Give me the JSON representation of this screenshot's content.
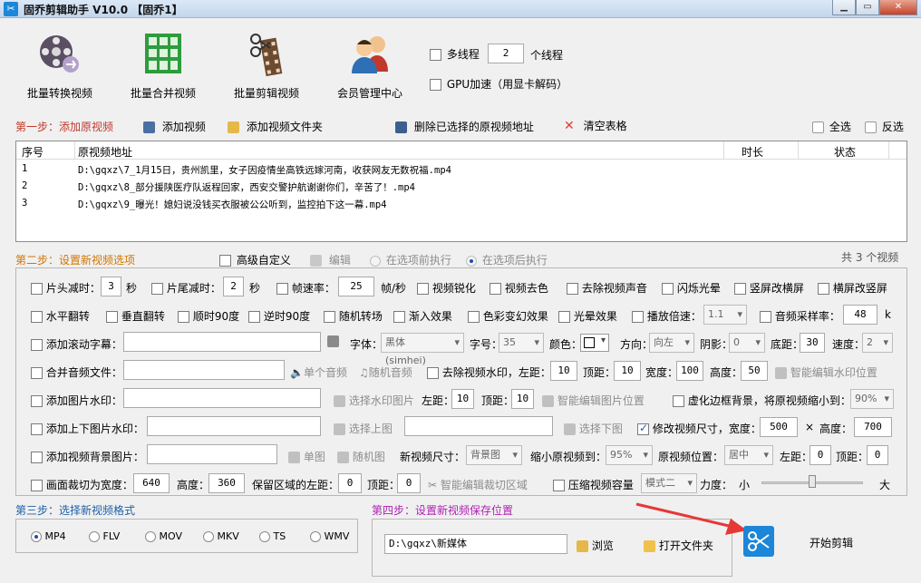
{
  "window": {
    "title": "固乔剪辑助手 V10.0 【固乔1】"
  },
  "toolbar": {
    "batch_convert": "批量转换视频",
    "batch_merge": "批量合并视频",
    "batch_edit": "批量剪辑视频",
    "member_center": "会员管理中心",
    "multithread_label": "多线程",
    "thread_count": "2",
    "thread_unit": "个线程",
    "gpu_label": "GPU加速（用显卡解码）"
  },
  "step1": {
    "title": "第一步：添加原视频",
    "add_video": "添加视频",
    "add_folder": "添加视频文件夹",
    "delete_selected": "删除已选择的原视频地址",
    "clear_table": "清空表格",
    "select_all": "全选",
    "invert_select": "反选"
  },
  "table": {
    "headers": [
      "序号",
      "原视频地址",
      "时长",
      "状态"
    ],
    "rows": [
      {
        "no": "1",
        "path": "D:\\gqxz\\7_1月15日，贵州凯里，女子因疫情坐高铁远嫁河南，收获网友无数祝福.mp4"
      },
      {
        "no": "2",
        "path": "D:\\gqxz\\8_部分援陕医疗队返程回家，西安交警护航谢谢你们，辛苦了！.mp4"
      },
      {
        "no": "3",
        "path": "D:\\gqxz\\9_曝光！媳妇说没钱买衣服被公公听到，监控拍下这一幕.mp4"
      }
    ]
  },
  "step2": {
    "title": "第二步：设置新视频选项",
    "advanced_custom": "高级自定义",
    "edit": "编辑",
    "before_exec": "在选项前执行",
    "after_exec": "在选项后执行",
    "total_count": "共 3 个视频"
  },
  "options": {
    "row1": {
      "head_cut": "片头减时：",
      "head_cut_val": "3",
      "sec1": "秒",
      "tail_cut": "片尾减时：",
      "tail_cut_val": "2",
      "sec2": "秒",
      "frame_rate": "帧速率：",
      "frame_rate_val": "25",
      "fps_unit": "帧/秒",
      "sharpen": "视频锐化",
      "desaturate": "视频去色",
      "remove_audio": "去除视频声音",
      "flash": "闪烁光晕",
      "v2h": "竖屏改横屏",
      "h2v": "横屏改竖屏"
    },
    "row2": {
      "hflip": "水平翻转",
      "vflip": "垂直翻转",
      "rot90cw": "顺时90度",
      "rot90ccw": "逆时90度",
      "random_trans": "随机转场",
      "fade_in": "渐入效果",
      "color_change": "色彩变幻效果",
      "halo": "光晕效果",
      "speed": "播放倍速：",
      "speed_val": "1.1",
      "sample_rate": "音频采样率：",
      "sample_rate_val": "48",
      "k": "k"
    },
    "row3": {
      "scroll_sub": "添加滚动字幕：",
      "font": "字体：",
      "font_val": "黑体 (simhei)",
      "size": "字号：",
      "size_val": "35",
      "color": "颜色：",
      "direction": "方向：",
      "direction_val": "向左",
      "shadow": "阴影：",
      "shadow_val": "0",
      "bottom": "底距：",
      "bottom_val": "30",
      "speed": "速度：",
      "speed_val": "2"
    },
    "row4": {
      "merge_audio": "合并音频文件：",
      "single_audio": "单个音频",
      "random_audio": "随机音频",
      "remove_watermark": "去除视频水印，左距：",
      "left_val": "10",
      "top": "顶距：",
      "top_val": "10",
      "width": "宽度：",
      "width_val": "100",
      "height": "高度：",
      "height_val": "50",
      "smart_wm": "智能编辑水印位置"
    },
    "row5": {
      "img_wm": "添加图片水印：",
      "choose_wm_img": "选择水印图片",
      "left": "左距：",
      "left_val": "10",
      "top": "顶距：",
      "top_val": "10",
      "smart_img": "智能编辑图片位置",
      "blur_border": "虚化边框背景，将原视频缩小到：",
      "shrink_val": "90%"
    },
    "row6": {
      "topbottom_wm": "添加上下图片水印：",
      "choose_top": "选择上图",
      "choose_bottom": "选择下图",
      "resize": "修改视频尺寸，宽度：",
      "w_val": "500",
      "x": "×",
      "h_label": "高度：",
      "h_val": "700"
    },
    "row7": {
      "bg_img": "添加视频背景图片：",
      "single_img": "单图",
      "random_img": "随机图",
      "new_size": "新视频尺寸：",
      "new_size_val": "背景图",
      "shrink_to": "缩小原视频到：",
      "shrink_to_val": "95%",
      "orig_pos": "原视频位置：",
      "orig_pos_val": "居中",
      "left": "左距：",
      "left_val": "0",
      "top": "顶距：",
      "top_val": "0"
    },
    "row8": {
      "crop": "画面裁切为宽度：",
      "crop_w": "640",
      "height": "高度：",
      "crop_h": "360",
      "keep_left": "保留区域的左距：",
      "keep_left_val": "0",
      "top": "顶距：",
      "top_val": "0",
      "smart_crop": "智能编辑裁切区域",
      "compress": "压缩视频容量",
      "mode_val": "模式二",
      "strength": "力度：",
      "small": "小",
      "large": "大"
    }
  },
  "step3": {
    "title": "第三步：选择新视频格式",
    "formats": [
      "MP4",
      "FLV",
      "MOV",
      "MKV",
      "TS",
      "WMV"
    ],
    "selected": "MP4"
  },
  "step4": {
    "title": "第四步：设置新视频保存位置",
    "path": "D:\\gqxz\\新媒体",
    "browse": "浏览",
    "open_folder": "打开文件夹",
    "start": "开始剪辑"
  },
  "colors": {
    "accent": "#1c86d8",
    "arrow": "#e53935",
    "step_red": "#c0392b",
    "step_orange": "#d27500",
    "step_blue": "#1f5fa8",
    "step_purple": "#b01fb3"
  }
}
